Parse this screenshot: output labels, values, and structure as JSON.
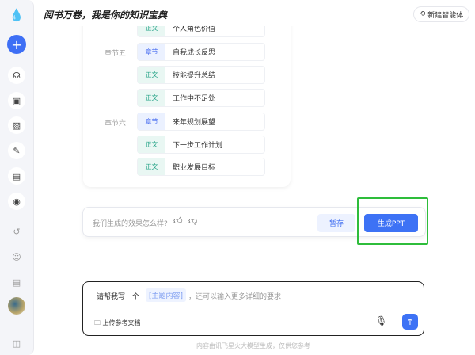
{
  "header": {
    "title": "阅书万卷，我是你的知识宝典",
    "new_agent": "新建智能体"
  },
  "outline": {
    "rows": [
      {
        "tag": "正文",
        "type": "z",
        "text": "个人角色价值"
      },
      {
        "tag": "章节",
        "type": "c",
        "text": "自我成长反思",
        "chapter": "章节五"
      },
      {
        "tag": "正文",
        "type": "z",
        "text": "技能提升总结"
      },
      {
        "tag": "正文",
        "type": "z",
        "text": "工作中不足处"
      },
      {
        "tag": "章节",
        "type": "c",
        "text": "来年规划展望",
        "chapter": "章节六"
      },
      {
        "tag": "正文",
        "type": "z",
        "text": "下一步工作计划"
      },
      {
        "tag": "正文",
        "type": "z",
        "text": "职业发展目标"
      }
    ]
  },
  "feedback": {
    "question": "我们生成的效果怎么样?",
    "save": "暂存",
    "generate": "生成PPT"
  },
  "input": {
    "prefix": "请帮我写一个",
    "chip": "[主题内容]",
    "suffix": "，还可以输入更多详细的要求",
    "upload": "上传参考文档"
  },
  "footer": "内容由讯飞星火大模型生成，仅供您参考",
  "colors": {
    "accent": "#3d72f5",
    "highlight": "#2ebd3b"
  }
}
